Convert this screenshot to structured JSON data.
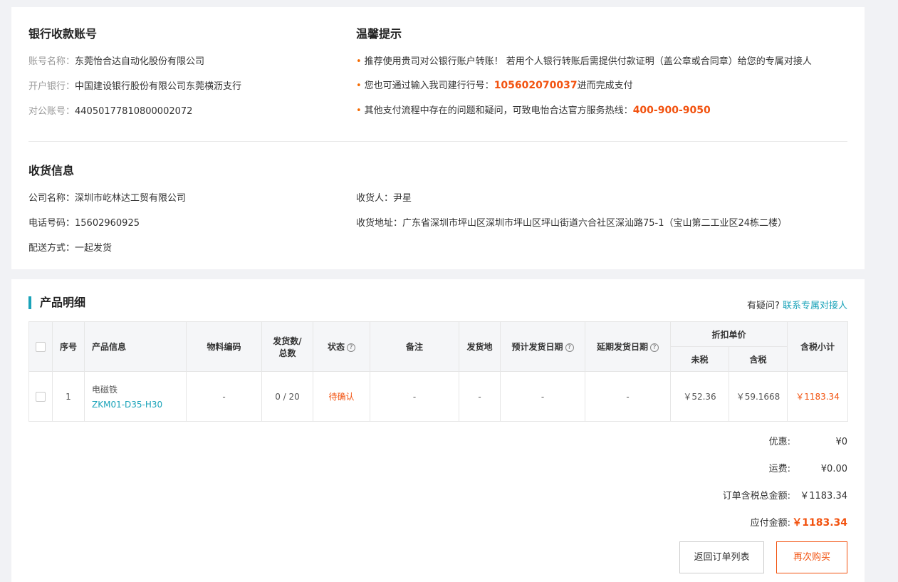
{
  "bank": {
    "title": "银行收款账号",
    "account_name_label": "账号名称：",
    "account_name": "东莞怡合达自动化股份有限公司",
    "bank_label": "开户银行：",
    "bank": "中国建设银行股份有限公司东莞横沥支行",
    "account_no_label": "对公账号：",
    "account_no": "44050177810800002072"
  },
  "tips": {
    "title": "温馨提示",
    "tip1": "推荐使用贵司对公银行账户转账！ 若用个人银行转账后需提供付款证明（盖公章或合同章）给您的专属对接人",
    "tip2_pre": "您也可通过输入我司建行行号：",
    "tip2_code": "105602070037",
    "tip2_post": "进而完成支付",
    "tip3_pre": "其他支付流程中存在的问题和疑问，可致电怡合达官方服务热线：",
    "tip3_phone": "400-900-9050"
  },
  "shipping": {
    "title": "收货信息",
    "company_label": "公司名称：",
    "company": "深圳市屹林达工贸有限公司",
    "phone_label": "电话号码：",
    "phone": "15602960925",
    "delivery_label": "配送方式：",
    "delivery": "一起发货",
    "receiver_label": "收货人：",
    "receiver": "尹星",
    "address_label": "收货地址：",
    "address": "广东省深圳市坪山区深圳市坪山区坪山街道六合社区深汕路75-1（宝山第二工业区24栋二楼）"
  },
  "detail": {
    "title": "产品明细",
    "question": "有疑问?",
    "contact_link": "联系专属对接人",
    "headers": {
      "seq": "序号",
      "product": "产品信息",
      "material": "物料编码",
      "ship_qty_1": "发货数/",
      "ship_qty_2": "总数",
      "status": "状态",
      "remark": "备注",
      "origin": "发货地",
      "plan_date": "预计发货日期",
      "delay_date": "延期发货日期",
      "unit_price": "折扣单价",
      "no_tax": "未税",
      "tax": "含税",
      "subtotal": "含税小计"
    },
    "rows": [
      {
        "seq": "1",
        "name": "电磁铁",
        "code": "ZKM01-D35-H30",
        "material": "-",
        "qty": "0 / 20",
        "status": "待确认",
        "remark": "-",
        "origin": "-",
        "plan_date": "-",
        "delay_date": "-",
        "price_no_tax": "￥52.36",
        "price_tax": "￥59.1668",
        "subtotal": "￥1183.34"
      }
    ]
  },
  "summary": {
    "discount_label": "优惠:",
    "discount": "¥0",
    "freight_label": "运费:",
    "freight": "¥0.00",
    "total_label": "订单含税总金额:",
    "total": "￥1183.34",
    "payable_label": "应付金额:",
    "payable": "￥1183.34"
  },
  "actions": {
    "back": "返回订单列表",
    "rebuy": "再次购买"
  }
}
